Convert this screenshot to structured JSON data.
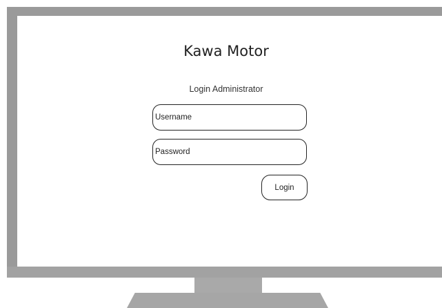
{
  "app": {
    "title": "Kawa Motor",
    "subtitle": "Login Administrator"
  },
  "form": {
    "username": {
      "placeholder": "Username",
      "value": ""
    },
    "password": {
      "placeholder": "Password",
      "value": ""
    },
    "login_label": "Login"
  },
  "colors": {
    "bezel": "#9a9a9a",
    "stand": "#a9a9a9",
    "screen": "#ffffff",
    "outline": "#222222"
  }
}
